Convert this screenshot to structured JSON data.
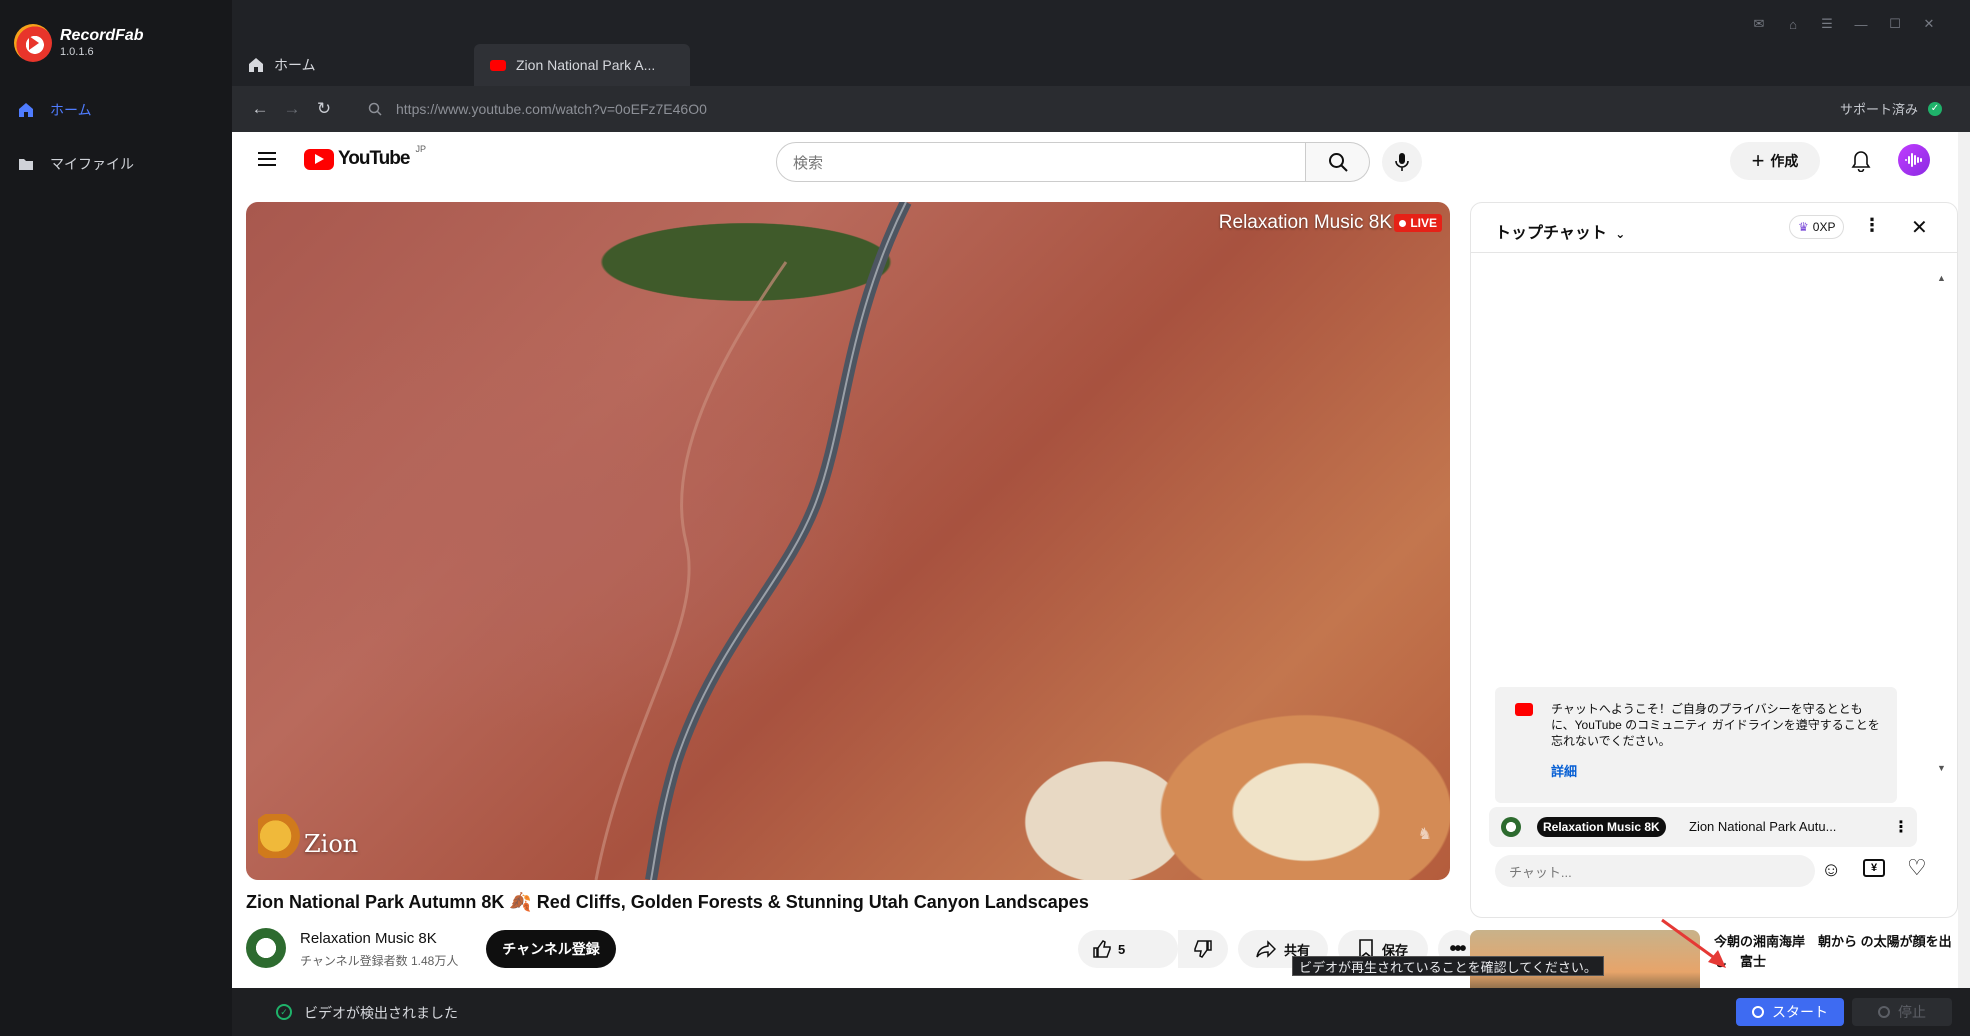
{
  "app": {
    "name": "RecordFab",
    "version": "1.0.1.6"
  },
  "sidebar": {
    "items": [
      {
        "label": "ホーム",
        "active": true
      },
      {
        "label": "マイファイル",
        "active": false
      }
    ]
  },
  "tabs": [
    {
      "label": "ホーム"
    },
    {
      "label": "Zion National Park A..."
    }
  ],
  "address": {
    "url": "https://www.youtube.com/watch?v=0oEFz7E46O0",
    "support": "サポート済み"
  },
  "youtube": {
    "logo_text": "YouTube",
    "region": "JP",
    "search_placeholder": "検索",
    "create_label": "作成",
    "video": {
      "overlay_channel": "Relaxation Music 8K",
      "live_badge": "LIVE",
      "watermark_text": "Zion",
      "title": "Zion National Park Autumn 8K 🍂 Red Cliffs, Golden Forests & Stunning Utah Canyon Landscapes",
      "channel": "Relaxation Music 8K",
      "subscribers": "チャンネル登録者数 1.48万人",
      "subscribe_label": "チャンネル登録",
      "likes": "5",
      "share_label": "共有",
      "save_label": "保存"
    },
    "chat": {
      "title": "トップチャット",
      "xp": "0XP",
      "welcome": "チャットへようこそ！ご自身のプライバシーを守るとともに、YouTube のコミュニティ ガイドラインを遵守することを忘れないでください。",
      "welcome_link": "詳細",
      "pinned_channel": "Relaxation Music 8K",
      "pinned_text": "Zion National Park Autu...",
      "input_placeholder": "チャット..."
    },
    "recommendation": {
      "title": "今朝の湘南海岸　朝から の太陽が顔を出し　富士"
    }
  },
  "tooltip": "ビデオが再生されていることを確認してください。",
  "status": {
    "text": "ビデオが検出されました",
    "start_label": "スタート",
    "stop_label": "停止"
  },
  "colors": {
    "accent": "#3e6bf2",
    "youtube_red": "#ff0000",
    "ok_green": "#1fb26a"
  }
}
